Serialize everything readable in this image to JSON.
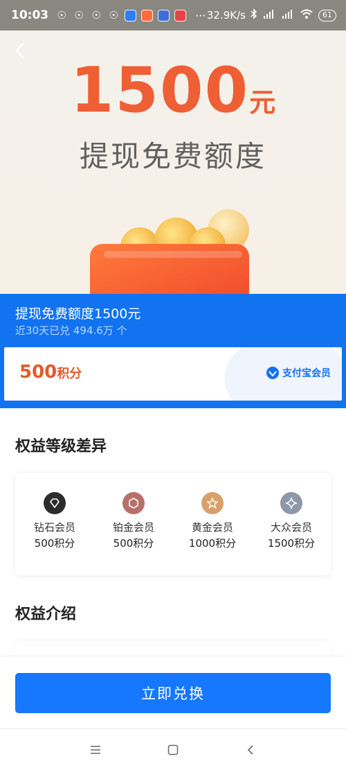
{
  "status_bar": {
    "time": "10:03",
    "network_speed": "32.9K/s",
    "battery": "61",
    "more": "···",
    "app_icons": [
      "notification-icon",
      "notification-icon",
      "notification-icon",
      "notification-icon",
      "app-icon",
      "app-icon",
      "app-icon",
      "app-icon"
    ],
    "connectivity_icons": [
      "bluetooth-icon",
      "hd-signal-icon",
      "signal-icon",
      "wifi-icon"
    ]
  },
  "hero": {
    "amount": "1500",
    "unit": "元",
    "subtitle": "提现免费额度"
  },
  "product": {
    "title": "提现免费额度1500元",
    "redeemed": "近30天已兑 494.6万 个",
    "price_number": "500",
    "price_unit": "积分",
    "brand": "支付宝会员"
  },
  "tier_section": {
    "title": "权益等级差异",
    "tiers": [
      {
        "name": "钻石会员",
        "points": "500积分",
        "icon": "diamond-icon",
        "color": "#2c2c2c"
      },
      {
        "name": "铂金会员",
        "points": "500积分",
        "icon": "platinum-hexagon-icon",
        "color": "#b86f6a"
      },
      {
        "name": "黄金会员",
        "points": "1000积分",
        "icon": "gold-star-icon",
        "color": "#d9a06a"
      },
      {
        "name": "大众会员",
        "points": "1500积分",
        "icon": "silver-sparkle-icon",
        "color": "#8e98a6"
      }
    ]
  },
  "intro_section": {
    "title": "权益介绍"
  },
  "cta": {
    "label": "立即兑换"
  },
  "nav": [
    "menu-icon",
    "home-icon",
    "back-icon"
  ],
  "colors": {
    "accent_blue": "#1273f0",
    "hero_orange": "#ef5f35",
    "price_red": "#e05a2a"
  }
}
